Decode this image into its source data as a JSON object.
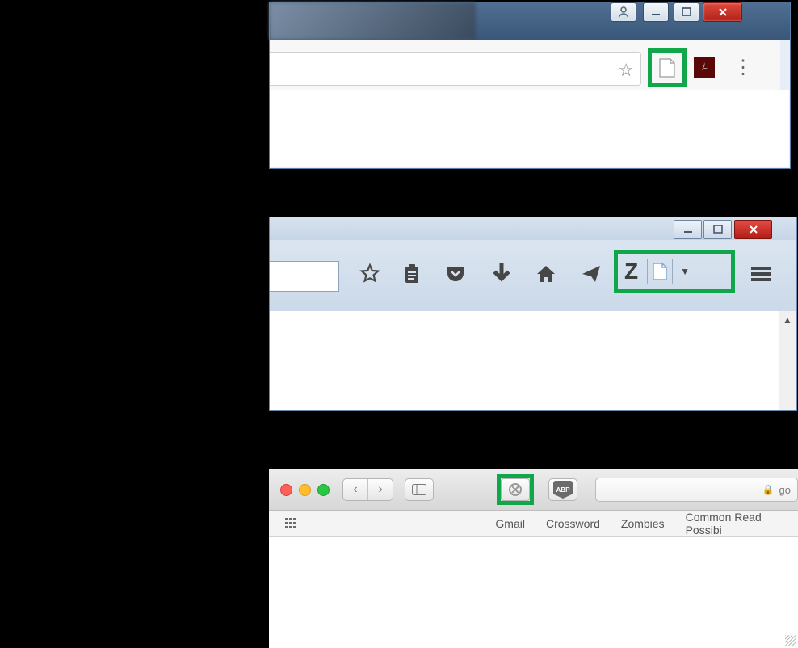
{
  "highlight_color": "#10a64a",
  "chrome": {
    "window_controls": {
      "user": "account",
      "min": "minimize",
      "max": "maximize",
      "close": "close"
    },
    "extension": {
      "name": "Zotero page connector"
    },
    "adobe_ext": "Adobe Acrobat",
    "menu": "⋮"
  },
  "firefox": {
    "window_controls": {
      "min": "minimize",
      "max": "maximize",
      "close": "close"
    },
    "toolbar_icons": {
      "star": "Bookmark",
      "clipboard": "Reading list",
      "pocket": "Pocket",
      "download": "Downloads",
      "home": "Home",
      "send": "Send tab"
    },
    "zotero_button": {
      "label": "Z",
      "page": "Save page",
      "dropdown": "▼"
    },
    "hamburger": "Menu"
  },
  "safari": {
    "traffic": {
      "close": "close",
      "min": "minimize",
      "zoom": "zoom"
    },
    "nav": {
      "back": "‹",
      "forward": "›"
    },
    "sidebar_button": "Sidebar",
    "zotero_button": "Zotero",
    "abp": "ABP",
    "url_prefix": "go",
    "favorites": [
      "Gmail",
      "Crossword",
      "Zombies",
      "Common Read Possibi"
    ]
  }
}
